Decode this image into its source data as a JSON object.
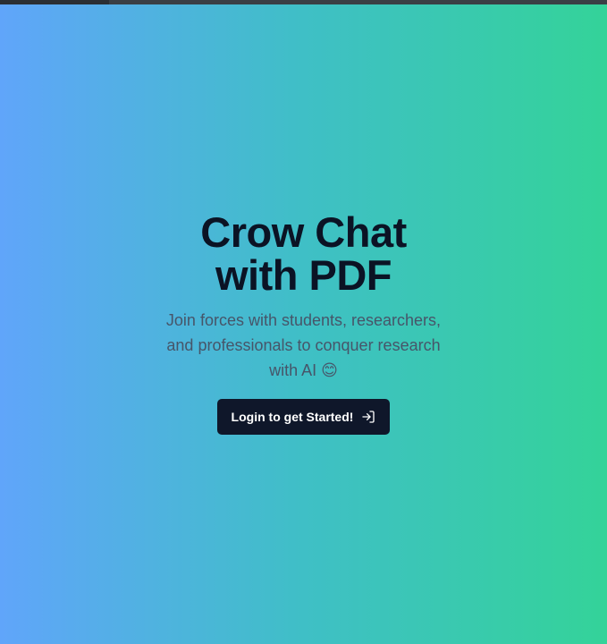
{
  "hero": {
    "title_line1": "Crow Chat",
    "title_line2": "with PDF",
    "subtitle": "Join forces with students, researchers, and professionals to conquer research with AI 😊"
  },
  "cta": {
    "label": "Login to get Started!",
    "icon": "log-in-icon"
  },
  "colors": {
    "gradient_start": "#60a5fa",
    "gradient_end": "#34d399",
    "title": "#0b1324",
    "subtitle": "#475569",
    "button_bg": "#0f172a",
    "button_text": "#ffffff"
  }
}
